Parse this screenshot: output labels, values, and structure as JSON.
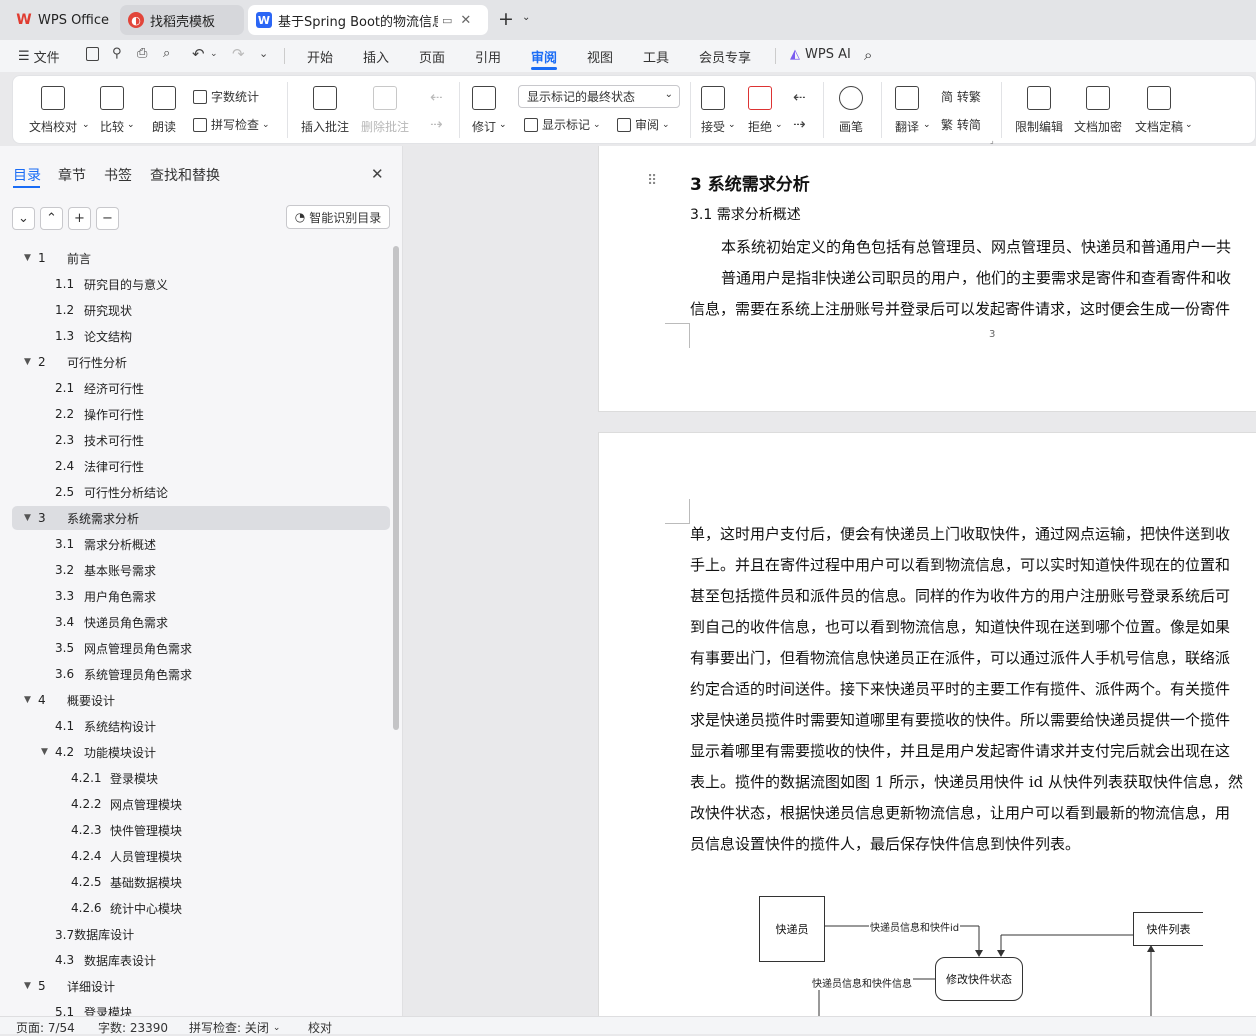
{
  "tabs": [
    {
      "label": "WPS Office",
      "active": false
    },
    {
      "label": "找稻壳模板",
      "active": false
    },
    {
      "label": "基于Spring Boot的物流信息管",
      "active": true
    }
  ],
  "menu": {
    "file": "文件",
    "items": [
      "开始",
      "插入",
      "页面",
      "引用",
      "审阅",
      "视图",
      "工具",
      "会员专享"
    ],
    "active": "审阅",
    "ai": "WPS AI"
  },
  "ribbon": {
    "doc_check": "文档校对",
    "compare": "比较",
    "read": "朗读",
    "word_count": "字数统计",
    "spell_check": "拼写检查",
    "insert_comment": "插入批注",
    "delete_comment": "删除批注",
    "revise": "修订",
    "markup_select": "显示标记的最终状态",
    "show_markup": "显示标记",
    "review": "审阅",
    "accept": "接受",
    "reject": "拒绝",
    "pen": "画笔",
    "translate": "翻译",
    "to_traditional": "简 转繁",
    "to_simplified": "繁 转简",
    "restrict_edit": "限制编辑",
    "encrypt": "文档加密",
    "finalize": "文档定稿"
  },
  "sidebar": {
    "tabs": [
      "目录",
      "章节",
      "书签",
      "查找和替换"
    ],
    "active_tab": "目录",
    "smart_button": "智能识别目录",
    "outline": [
      {
        "num": "1",
        "text": "前言",
        "level": 1,
        "expanded": true
      },
      {
        "num": "1.1",
        "text": "研究目的与意义",
        "level": 2
      },
      {
        "num": "1.2",
        "text": "研究现状",
        "level": 2
      },
      {
        "num": "1.3",
        "text": "论文结构",
        "level": 2
      },
      {
        "num": "2",
        "text": "可行性分析",
        "level": 1,
        "expanded": true
      },
      {
        "num": "2.1",
        "text": "经济可行性",
        "level": 2
      },
      {
        "num": "2.2",
        "text": "操作可行性",
        "level": 2
      },
      {
        "num": "2.3",
        "text": "技术可行性",
        "level": 2
      },
      {
        "num": "2.4",
        "text": "法律可行性",
        "level": 2
      },
      {
        "num": "2.5",
        "text": "可行性分析结论",
        "level": 2
      },
      {
        "num": "3",
        "text": "系统需求分析",
        "level": 1,
        "expanded": true,
        "selected": true
      },
      {
        "num": "3.1",
        "text": "需求分析概述",
        "level": 2
      },
      {
        "num": "3.2",
        "text": "基本账号需求",
        "level": 2
      },
      {
        "num": "3.3",
        "text": "用户角色需求",
        "level": 2
      },
      {
        "num": "3.4",
        "text": "快递员角色需求",
        "level": 2
      },
      {
        "num": "3.5",
        "text": "网点管理员角色需求",
        "level": 2
      },
      {
        "num": "3.6",
        "text": "系统管理员角色需求",
        "level": 2
      },
      {
        "num": "4",
        "text": "概要设计",
        "level": 1,
        "expanded": true
      },
      {
        "num": "4.1",
        "text": "系统结构设计",
        "level": 2
      },
      {
        "num": "4.2",
        "text": "功能模块设计",
        "level": 2,
        "expanded": true
      },
      {
        "num": "4.2.1",
        "text": "登录模块",
        "level": 3
      },
      {
        "num": "4.2.2",
        "text": "网点管理模块",
        "level": 3
      },
      {
        "num": "4.2.3",
        "text": "快件管理模块",
        "level": 3
      },
      {
        "num": "4.2.4",
        "text": "人员管理模块",
        "level": 3
      },
      {
        "num": "4.2.5",
        "text": "基础数据模块",
        "level": 3
      },
      {
        "num": "4.2.6",
        "text": "统计中心模块",
        "level": 3
      },
      {
        "num": "",
        "text": "3.7数据库设计",
        "level": 2
      },
      {
        "num": "4.3",
        "text": "数据库表设计",
        "level": 2
      },
      {
        "num": "5",
        "text": "详细设计",
        "level": 1,
        "expanded": true
      },
      {
        "num": "5.1",
        "text": "登录模块",
        "level": 2
      }
    ]
  },
  "document": {
    "heading": "3   系统需求分析",
    "subheading": "3.1   需求分析概述",
    "page1_lines": [
      "本系统初始定义的角色包括有总管理员、网点管理员、快递员和普通用户一共",
      "普通用户是指非快递公司职员的用户，他们的主要需求是寄件和查看寄件和收",
      "信息，需要在系统上注册账号并登录后可以发起寄件请求，这时便会生成一份寄件"
    ],
    "page_number": "3",
    "page2_lines": [
      "单，这时用户支付后，便会有快递员上门收取快件，通过网点运输，把快件送到收",
      "手上。并且在寄件过程中用户可以看到物流信息，可以实时知道快件现在的位置和",
      "甚至包括揽件员和派件员的信息。同样的作为收件方的用户注册账号登录系统后可",
      "到自己的收件信息，也可以看到物流信息，知道快件现在送到哪个位置。像是如果",
      "有事要出门，但看物流信息快递员正在派件，可以通过派件人手机号信息，联络派",
      "约定合适的时间送件。接下来快递员平时的主要工作有揽件、派件两个。有关揽件",
      "求是快递员揽件时需要知道哪里有要揽收的快件。所以需要给快递员提供一个揽件",
      "显示着哪里有需要揽收的快件，并且是用户发起寄件请求并支付完后就会出现在这",
      "表上。揽件的数据流图如图 1 所示，快递员用快件 id 从快件列表获取快件信息，然",
      "改快件状态，根据快递员信息更新物流信息，让用户可以看到最新的物流信息，用",
      "员信息设置快件的揽件人，最后保存快件信息到快件列表。"
    ],
    "diagram": {
      "courier": "快递员",
      "express_list": "快件列表",
      "modify_status": "修改快件状态",
      "flow1": "快递员信息和快件id",
      "flow2": "快递员信息和快件信息"
    }
  },
  "status": {
    "page": "页面: 7/54",
    "words": "字数: 23390",
    "spell": "拼写检查: 关闭",
    "proof": "校对"
  },
  "colors": {
    "accent": "#1a6cf5",
    "wps_red": "#e03c31"
  }
}
